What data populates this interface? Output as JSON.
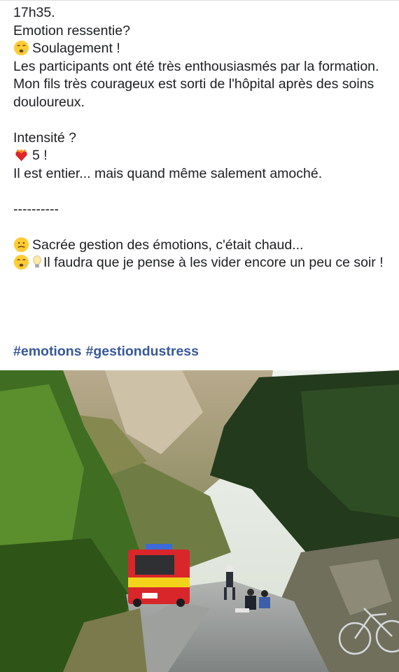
{
  "post": {
    "lines": [
      "17h35.",
      "Emotion ressentie?",
      "Soulagement !",
      "Les participants ont été très enthousiasmés par la formation.",
      "Mon fils très courageux est sorti de l'hôpital après des soins douloureux.",
      "Intensité ?",
      "5 !",
      "Il est entier... mais quand même salement amoché.",
      "----------",
      "Sacrée gestion des émotions, c'était chaud...",
      "Il faudra que je pense à les vider encore un peu ce soir !"
    ],
    "emojis": {
      "relief": "relieved-face-icon",
      "heart": "heart-on-fire-icon",
      "grimace": "grimacing-face-icon",
      "bulb": "light-bulb-icon"
    }
  },
  "hashtags": [
    "#emotions",
    "#gestiondustress"
  ],
  "colors": {
    "text": "#1c1e21",
    "hashtag": "#385898",
    "ambulance_red": "#d8262b",
    "ambulance_yellow": "#f3d21a"
  },
  "photo": {
    "alt": "Mountain road scene with ambulance, cyclist and bicycle"
  }
}
